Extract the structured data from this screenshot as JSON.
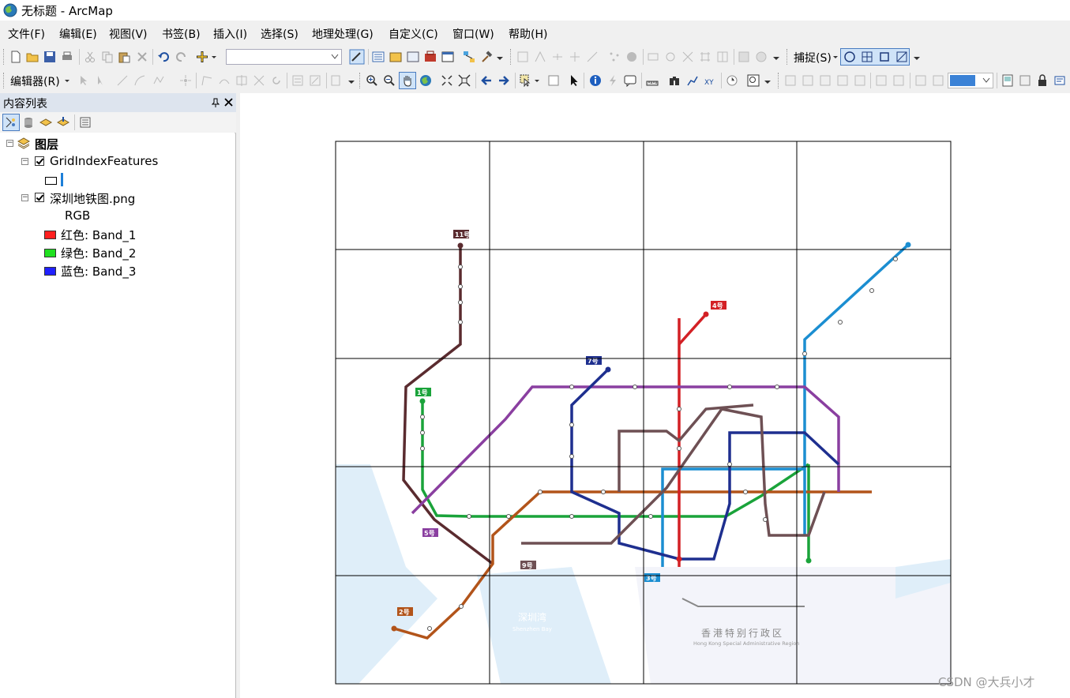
{
  "window": {
    "title": "无标题 - ArcMap"
  },
  "menu": [
    "文件(F)",
    "编辑(E)",
    "视图(V)",
    "书签(B)",
    "插入(I)",
    "选择(S)",
    "地理处理(G)",
    "自定义(C)",
    "窗口(W)",
    "帮助(H)"
  ],
  "toolbar": {
    "snapping_label": "捕捉(S)",
    "editor_label": "编辑器(R)",
    "scale_value": "",
    "layer_dropdown_value": ""
  },
  "toc": {
    "title": "内容列表",
    "root_label": "图层",
    "layers": [
      {
        "name": "GridIndexFeatures",
        "checked": true
      },
      {
        "name": "深圳地铁图.png",
        "checked": true
      }
    ],
    "rgb_label": "RGB",
    "bands": [
      {
        "label": "红色:   Band_1",
        "color": "#ff2020"
      },
      {
        "label": "绿色: Band_2",
        "color": "#20e020"
      },
      {
        "label": "蓝色:   Band_3",
        "color": "#2020ff"
      }
    ]
  },
  "map": {
    "line_badges": [
      "11号",
      "4号",
      "7号",
      "1号",
      "5号",
      "2号",
      "9号",
      "3号"
    ],
    "labels": {
      "shenzhen_bay": "深圳湾",
      "shenzhen_bay_en": "Shenzhen Bay",
      "hongkong": "香港特别行政区",
      "hongkong_en": "Hong Kong Special Administrative Region"
    },
    "line_colors": {
      "line1": "#1aa33a",
      "line2": "#b2541a",
      "line3": "#1b8ed1",
      "line4": "#d32025",
      "line5": "#8a3fa0",
      "line7": "#1e2f8f",
      "line9": "#6e5054",
      "line11": "#5a2b2f"
    }
  },
  "watermark": "CSDN @大兵小才"
}
